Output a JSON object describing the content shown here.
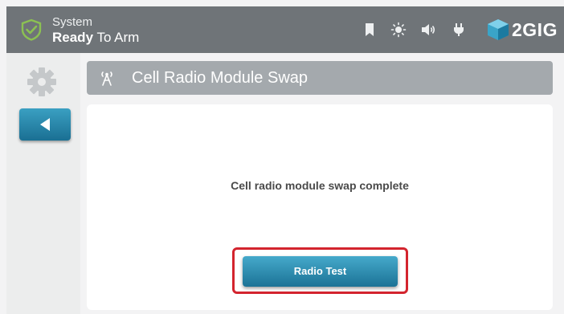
{
  "status_bar": {
    "system_label": "System",
    "status_bold": "Ready",
    "status_rest": " To Arm",
    "icons": [
      "shield-check-icon",
      "bookmark-icon",
      "brightness-icon",
      "volume-icon",
      "power-plug-icon"
    ],
    "brand": "2GIG"
  },
  "sidebar": {
    "icons": [
      "gear-icon",
      "back-arrow-icon"
    ]
  },
  "header": {
    "icon": "cell-tower-icon",
    "title": "Cell Radio Module Swap"
  },
  "main": {
    "message": "Cell radio module swap complete",
    "radio_test_label": "Radio Test"
  },
  "colors": {
    "topbar": "#6f7478",
    "accent_button": "#2a8db2",
    "highlight": "#d3242e",
    "shield": "#7bc043"
  }
}
